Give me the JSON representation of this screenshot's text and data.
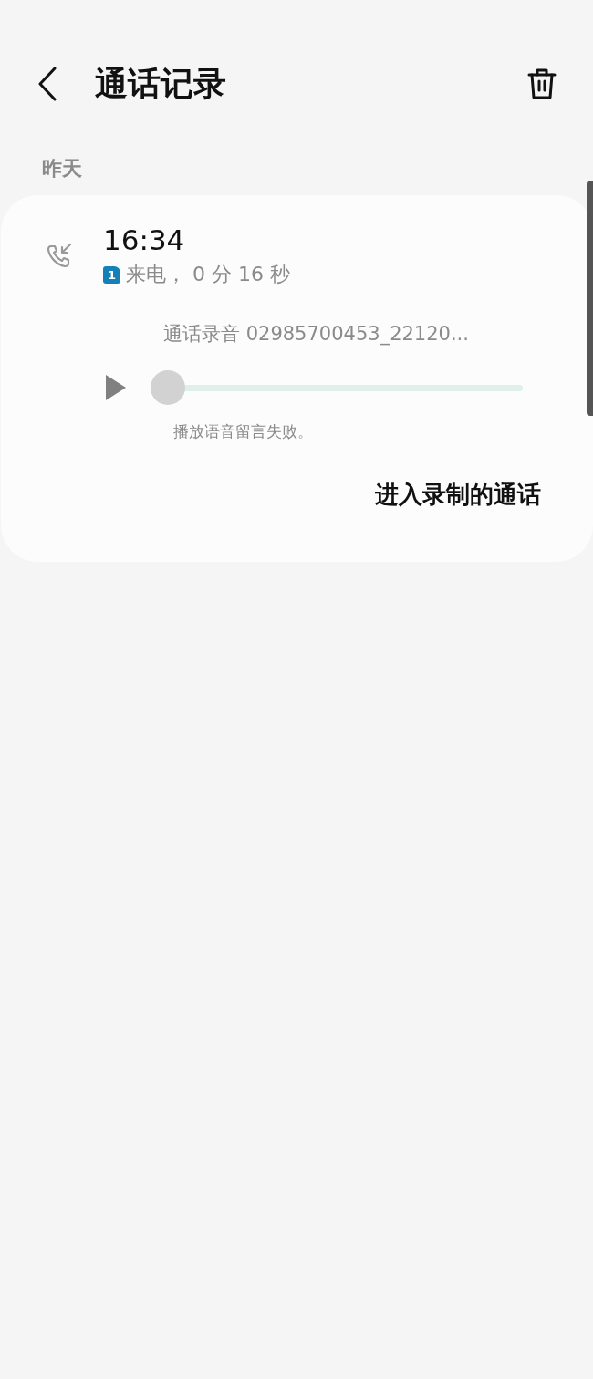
{
  "header": {
    "title": "通话记录"
  },
  "section": {
    "label": "昨天"
  },
  "call": {
    "time": "16:34",
    "sim": "1",
    "detail": "来电， 0 分 16 秒",
    "recording": {
      "name": "通话录音 02985700453_22120...",
      "playing": false,
      "level": 0,
      "error": "播放语音留言失败。"
    },
    "action": "进入录制的通话"
  }
}
